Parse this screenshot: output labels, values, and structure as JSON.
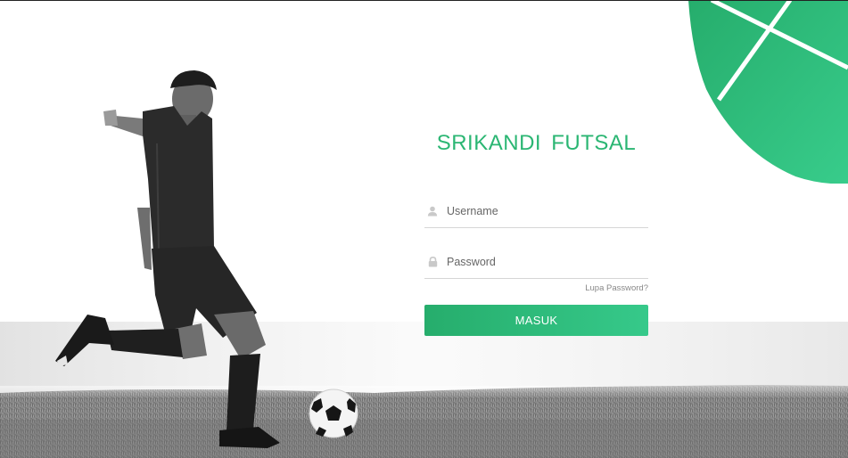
{
  "brand": {
    "title": "SRIKANDI  FUTSAL",
    "accent_color": "#2bb673"
  },
  "form": {
    "username": {
      "placeholder": "Username",
      "value": "",
      "icon": "user-icon"
    },
    "password": {
      "placeholder": "Password",
      "value": "",
      "icon": "lock-icon"
    },
    "forgot_label": "Lupa Password?",
    "submit_label": "MASUK",
    "button_color_start": "#26ad6c",
    "button_color_end": "#36c98a"
  },
  "hero": {
    "image": "football-player-kicking-ball-icon",
    "ball": "football-icon"
  }
}
